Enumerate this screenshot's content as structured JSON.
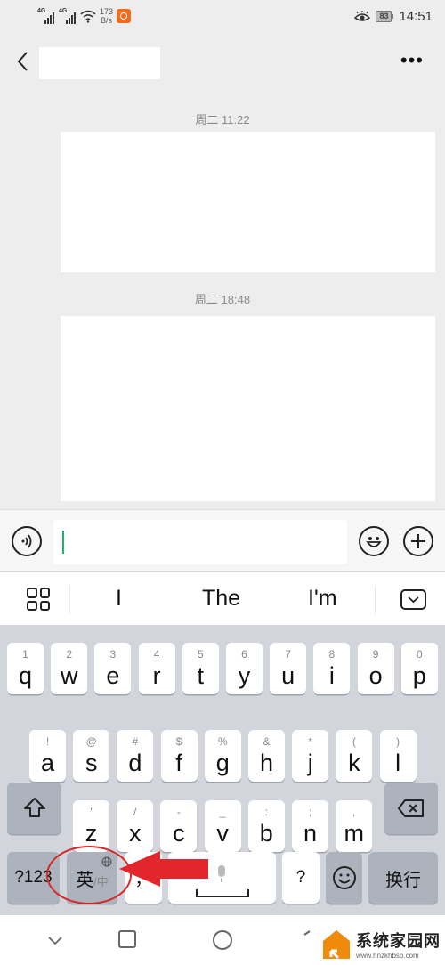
{
  "status_bar": {
    "network_1": "4G",
    "network_2": "4G",
    "speed_value": "173",
    "speed_unit": "B/s",
    "battery": "83",
    "time": "14:51"
  },
  "header": {
    "title": "",
    "back_icon": "chevron-left-icon",
    "more_icon": "more-dots-icon"
  },
  "chat": {
    "messages": [
      {
        "timestamp": "周二 11:22",
        "content": ""
      },
      {
        "timestamp": "周二 18:48",
        "content": ""
      }
    ]
  },
  "input_bar": {
    "voice_icon": "voice-icon",
    "value": "",
    "emoji_icon": "emoji-icon",
    "plus_icon": "plus-icon"
  },
  "suggestions": {
    "items": [
      "I",
      "The",
      "I'm"
    ]
  },
  "keyboard": {
    "row1": [
      {
        "main": "q",
        "sub": "1"
      },
      {
        "main": "w",
        "sub": "2"
      },
      {
        "main": "e",
        "sub": "3"
      },
      {
        "main": "r",
        "sub": "4"
      },
      {
        "main": "t",
        "sub": "5"
      },
      {
        "main": "y",
        "sub": "6"
      },
      {
        "main": "u",
        "sub": "7"
      },
      {
        "main": "i",
        "sub": "8"
      },
      {
        "main": "o",
        "sub": "9"
      },
      {
        "main": "p",
        "sub": "0"
      }
    ],
    "row2": [
      {
        "main": "a",
        "sub": "!"
      },
      {
        "main": "s",
        "sub": "@"
      },
      {
        "main": "d",
        "sub": "#"
      },
      {
        "main": "f",
        "sub": "$"
      },
      {
        "main": "g",
        "sub": "%"
      },
      {
        "main": "h",
        "sub": "&"
      },
      {
        "main": "j",
        "sub": "*"
      },
      {
        "main": "k",
        "sub": "("
      },
      {
        "main": "l",
        "sub": ")"
      }
    ],
    "row3": [
      {
        "main": "z",
        "sub": "'"
      },
      {
        "main": "x",
        "sub": "/"
      },
      {
        "main": "c",
        "sub": "-"
      },
      {
        "main": "v",
        "sub": "_"
      },
      {
        "main": "b",
        "sub": ":"
      },
      {
        "main": "n",
        "sub": ";"
      },
      {
        "main": "m",
        "sub": ","
      }
    ],
    "symbols_label": "?123",
    "lang_primary": "英",
    "lang_secondary": "/中",
    "comma_label": "，",
    "question_label": "?",
    "enter_label": "换行"
  },
  "watermark": {
    "title": "系统家园网",
    "url": "www.hnzkhbsb.com"
  },
  "colors": {
    "accent_green": "#21b36a",
    "annotation_red": "#d32b2b",
    "watermark_orange": "#f08a0a"
  }
}
